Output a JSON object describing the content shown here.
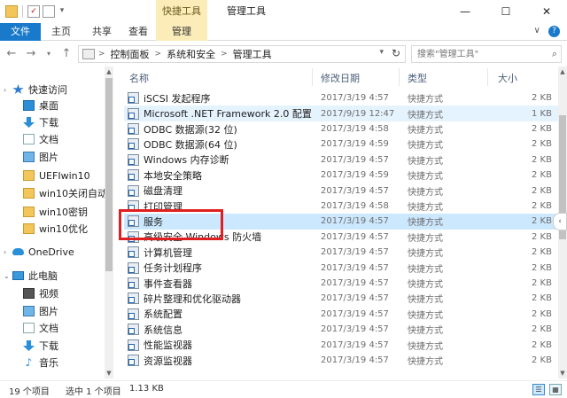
{
  "window": {
    "title": "管理工具",
    "contextual_tab_group": "快捷工具",
    "minimize": "—",
    "maximize": "☐",
    "close": "✕"
  },
  "ribbon": {
    "tabs": [
      "文件",
      "主页",
      "共享",
      "查看",
      "管理"
    ],
    "expand_icon": "∨",
    "help_icon": "?"
  },
  "address": {
    "breadcrumbs": [
      "控制面板",
      "系统和安全",
      "管理工具"
    ],
    "search_placeholder": "搜索\"管理工具\""
  },
  "columns": {
    "name": "名称",
    "date": "修改日期",
    "type": "类型",
    "size": "大小"
  },
  "sidebar": {
    "items": [
      {
        "label": "快速访问",
        "icon": "star-icon",
        "pinned": false
      },
      {
        "label": "桌面",
        "icon": "desktop-icon",
        "pinned": true
      },
      {
        "label": "下载",
        "icon": "download-icon",
        "pinned": true
      },
      {
        "label": "文档",
        "icon": "document-icon",
        "pinned": true
      },
      {
        "label": "图片",
        "icon": "picture-icon",
        "pinned": true
      },
      {
        "label": "UEFIwin10",
        "icon": "folder-icon",
        "pinned": false
      },
      {
        "label": "win10关闭自动更",
        "icon": "folder-icon",
        "pinned": false
      },
      {
        "label": "win10密钥",
        "icon": "folder-icon",
        "pinned": false
      },
      {
        "label": "win10优化",
        "icon": "folder-icon",
        "pinned": false
      },
      {
        "label": "OneDrive",
        "icon": "cloud-icon",
        "pinned": false
      },
      {
        "label": "此电脑",
        "icon": "computer-icon",
        "pinned": false
      },
      {
        "label": "视频",
        "icon": "video-icon",
        "pinned": false
      },
      {
        "label": "图片",
        "icon": "picture-icon",
        "pinned": false
      },
      {
        "label": "文档",
        "icon": "document-icon",
        "pinned": false
      },
      {
        "label": "下载",
        "icon": "download-icon",
        "pinned": false
      },
      {
        "label": "音乐",
        "icon": "music-icon",
        "pinned": false
      }
    ]
  },
  "files": [
    {
      "name": "iSCSI 发起程序",
      "date": "2017/3/19 4:57",
      "type": "快捷方式",
      "size": "2 KB"
    },
    {
      "name": "Microsoft .NET Framework 2.0 配置",
      "date": "2017/9/19 12:47",
      "type": "快捷方式",
      "size": "1 KB"
    },
    {
      "name": "ODBC 数据源(32 位)",
      "date": "2017/3/19 4:58",
      "type": "快捷方式",
      "size": "2 KB"
    },
    {
      "name": "ODBC 数据源(64 位)",
      "date": "2017/3/19 4:59",
      "type": "快捷方式",
      "size": "2 KB"
    },
    {
      "name": "Windows 内存诊断",
      "date": "2017/3/19 4:57",
      "type": "快捷方式",
      "size": "2 KB"
    },
    {
      "name": "本地安全策略",
      "date": "2017/3/19 4:59",
      "type": "快捷方式",
      "size": "2 KB"
    },
    {
      "name": "磁盘清理",
      "date": "2017/3/19 4:57",
      "type": "快捷方式",
      "size": "2 KB"
    },
    {
      "name": "打印管理",
      "date": "2017/3/19 4:58",
      "type": "快捷方式",
      "size": "2 KB"
    },
    {
      "name": "服务",
      "date": "2017/3/19 4:57",
      "type": "快捷方式",
      "size": "2 KB"
    },
    {
      "name": "高级安全 Windows 防火墙",
      "date": "2017/3/19 4:57",
      "type": "快捷方式",
      "size": "2 KB"
    },
    {
      "name": "计算机管理",
      "date": "2017/3/19 4:57",
      "type": "快捷方式",
      "size": "2 KB"
    },
    {
      "name": "任务计划程序",
      "date": "2017/3/19 4:57",
      "type": "快捷方式",
      "size": "2 KB"
    },
    {
      "name": "事件查看器",
      "date": "2017/3/19 4:57",
      "type": "快捷方式",
      "size": "2 KB"
    },
    {
      "name": "碎片整理和优化驱动器",
      "date": "2017/3/19 4:57",
      "type": "快捷方式",
      "size": "2 KB"
    },
    {
      "name": "系统配置",
      "date": "2017/3/19 4:57",
      "type": "快捷方式",
      "size": "2 KB"
    },
    {
      "name": "系统信息",
      "date": "2017/3/19 4:57",
      "type": "快捷方式",
      "size": "2 KB"
    },
    {
      "name": "性能监视器",
      "date": "2017/3/19 4:57",
      "type": "快捷方式",
      "size": "2 KB"
    },
    {
      "name": "资源监视器",
      "date": "2017/3/19 4:57",
      "type": "快捷方式",
      "size": "2 KB"
    }
  ],
  "selected_index": 8,
  "hover_index": 1,
  "status": {
    "item_count": "19 个项目",
    "selection": "选中 1 个项目",
    "size": "1.13 KB"
  },
  "colors": {
    "accent": "#1979ca",
    "contextual": "#fbecb8",
    "selection": "#cce8ff",
    "highlight_box": "#e02020"
  }
}
